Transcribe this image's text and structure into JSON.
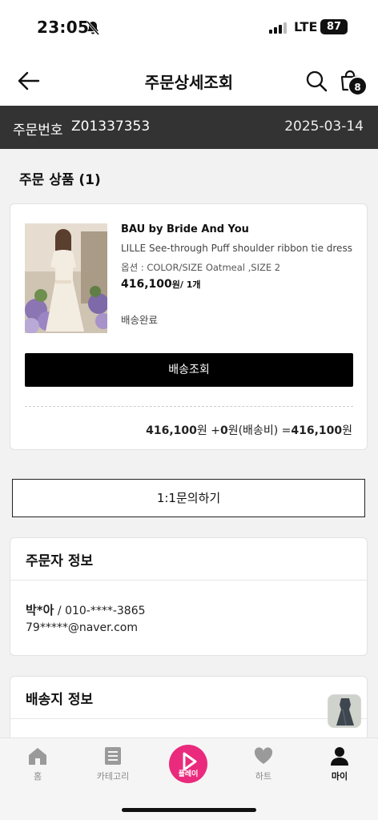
{
  "status_bar": {
    "time": "23:05",
    "network": "LTE",
    "battery": "87"
  },
  "header": {
    "title": "주문상세조회",
    "cart_count": "8"
  },
  "order": {
    "label": "주문번호",
    "number": "Z01337353",
    "date": "2025-03-14"
  },
  "products_section": {
    "title": "주문 상품 (1)"
  },
  "product": {
    "brand": "BAU by Bride And You",
    "name": "LILLE See-through Puff shoulder ribbon tie dress",
    "option": "옵션 : COLOR/SIZE Oatmeal ,SIZE 2",
    "price": "416,100",
    "price_unit": "원/ 1개",
    "status": "배송완료",
    "track_button": "배송조회"
  },
  "total": {
    "product_amount": "416,100",
    "product_unit": "원 +",
    "shipping_amount": "0",
    "shipping_unit": "원(배송비) =",
    "final_amount": "416,100",
    "final_unit": "원"
  },
  "inquiry_button": "1:1문의하기",
  "orderer": {
    "title": "주문자 정보",
    "name": "박*아",
    "phone": " / 010-****-3865",
    "email": "79*****@naver.com"
  },
  "shipping": {
    "title": "배송지 정보"
  },
  "bottom_nav": {
    "items": [
      {
        "label": "홈",
        "icon": "home-icon"
      },
      {
        "label": "카테고리",
        "icon": "category-icon"
      },
      {
        "label": "플레이",
        "icon": "play-icon"
      },
      {
        "label": "하트",
        "icon": "heart-icon"
      },
      {
        "label": "마이",
        "icon": "person-icon"
      }
    ]
  },
  "colors": {
    "dark_bar": "#333333",
    "play_accent": "#ea2a7c",
    "background": "#f2f2f2"
  }
}
